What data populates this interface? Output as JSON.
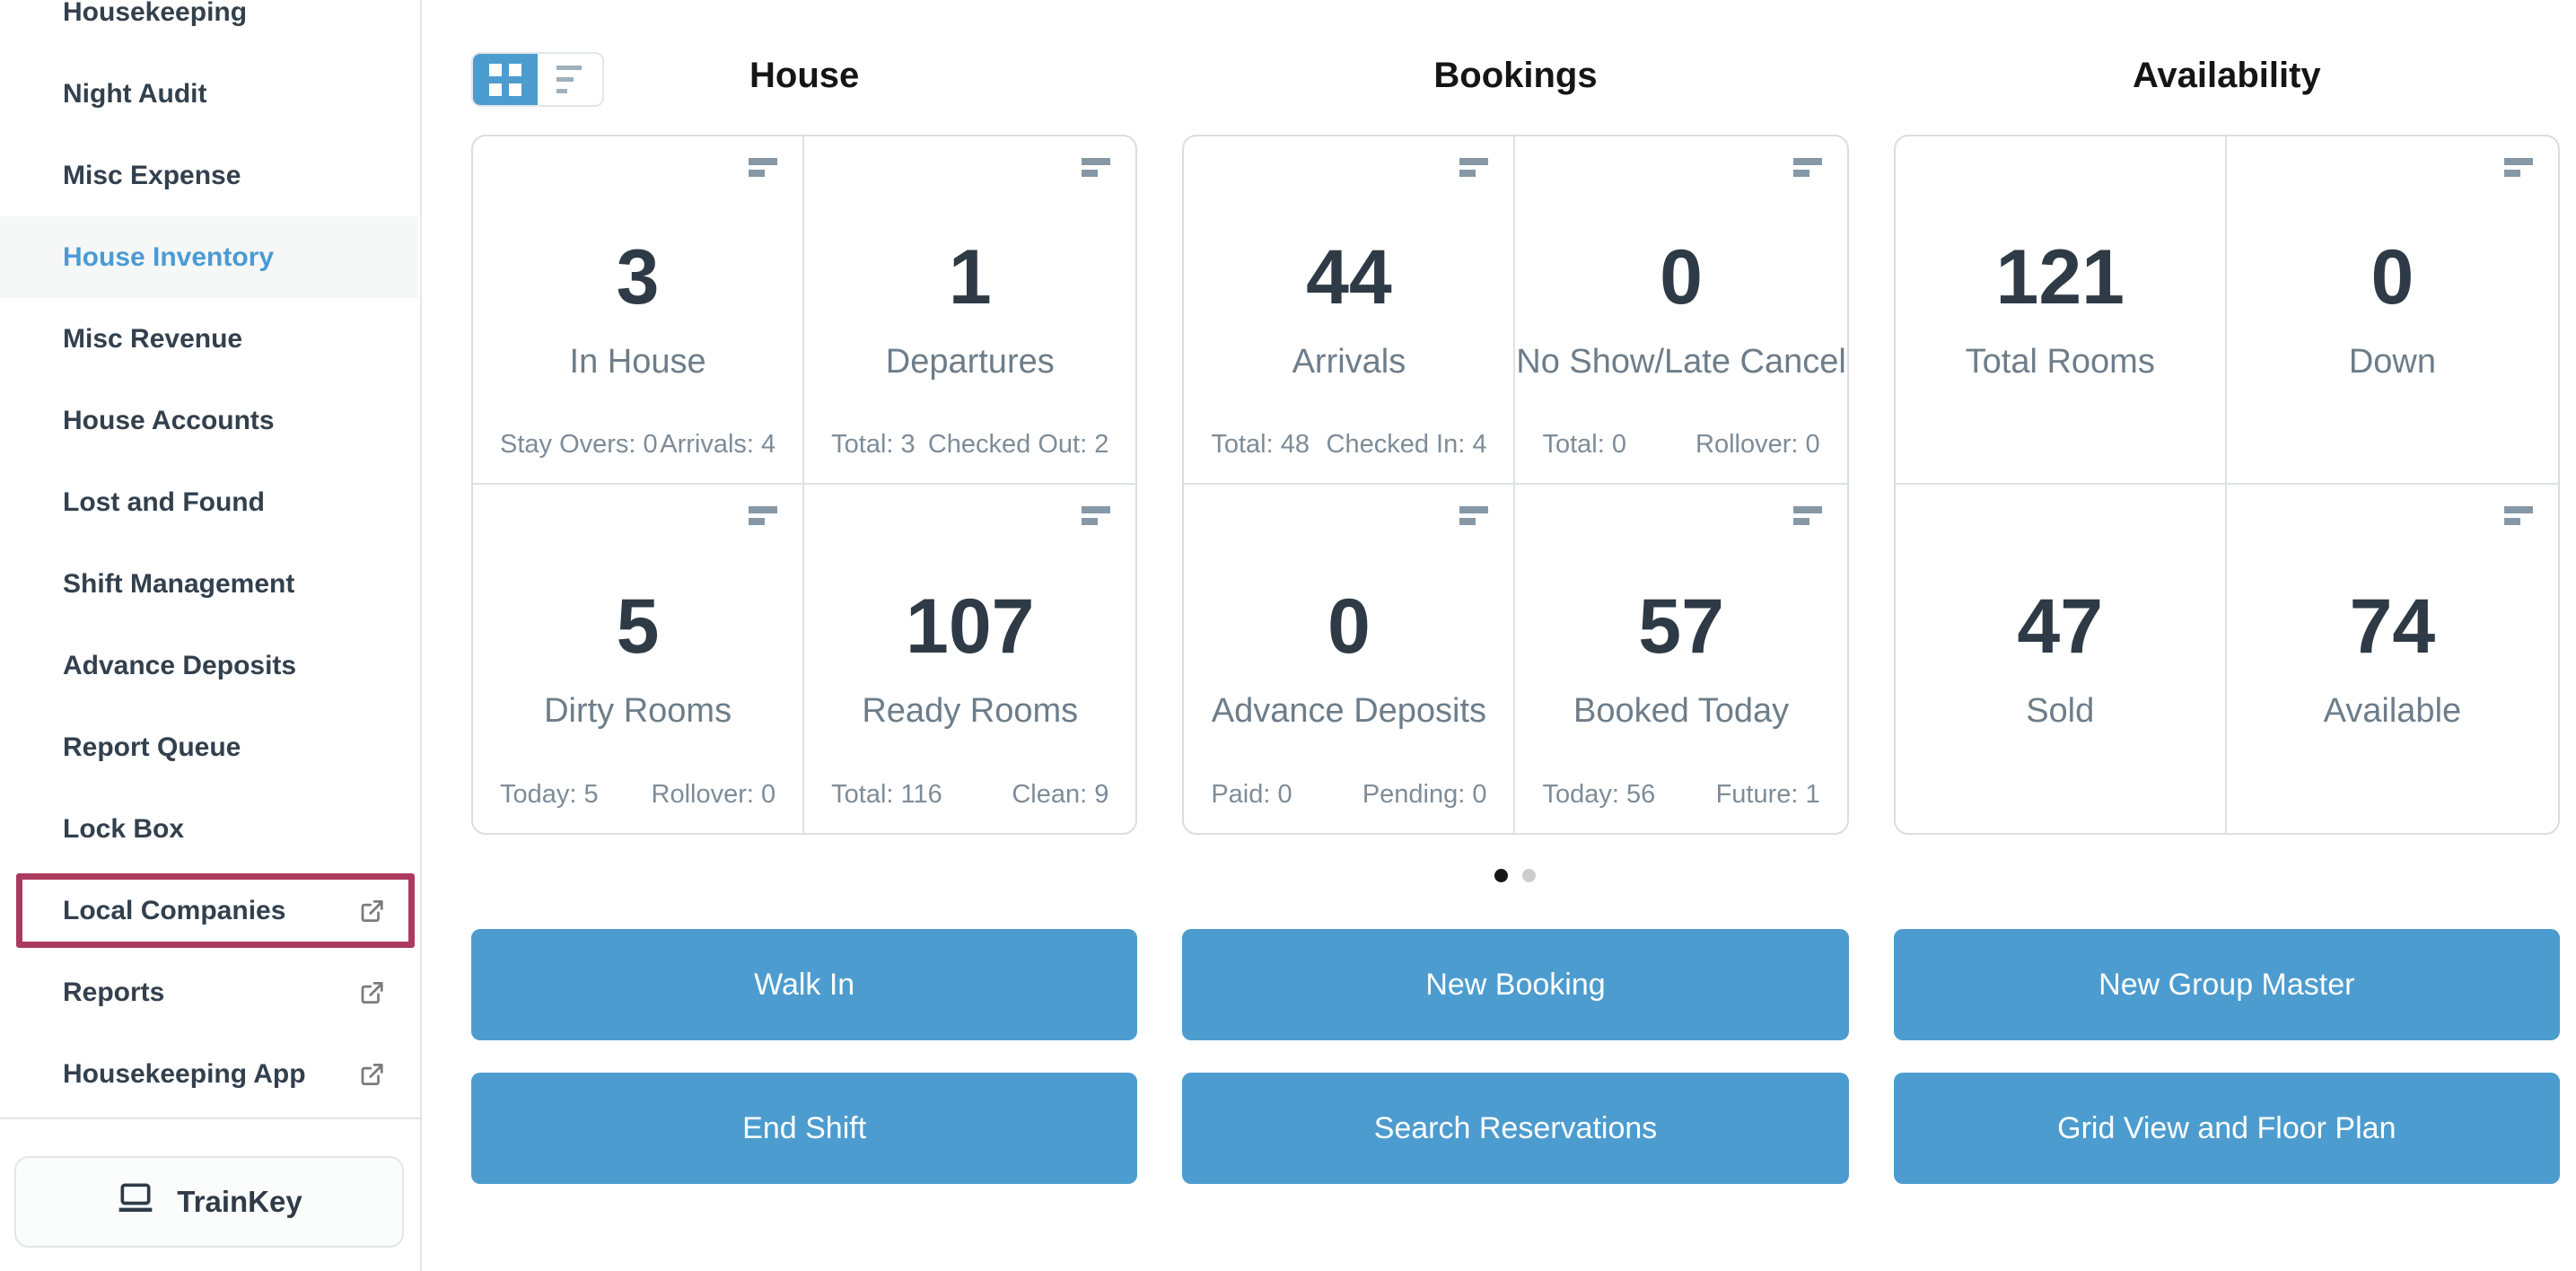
{
  "sidebar": {
    "items": [
      {
        "label": "Housekeeping"
      },
      {
        "label": "Night Audit"
      },
      {
        "label": "Misc Expense"
      },
      {
        "label": "House Inventory",
        "active": true
      },
      {
        "label": "Misc Revenue"
      },
      {
        "label": "House Accounts"
      },
      {
        "label": "Lost and Found"
      },
      {
        "label": "Shift Management"
      },
      {
        "label": "Advance Deposits"
      },
      {
        "label": "Report Queue"
      },
      {
        "label": "Lock Box"
      },
      {
        "label": "Local Companies",
        "external": true,
        "highlighted": true
      },
      {
        "label": "Reports",
        "external": true
      },
      {
        "label": "Housekeeping App",
        "external": true
      }
    ],
    "trainkey_label": "TrainKey"
  },
  "view_toggle": {
    "options": [
      "grid-view",
      "list-view"
    ],
    "selected": "grid-view"
  },
  "columns": [
    {
      "title": "House",
      "cards": [
        {
          "value": "3",
          "label": "In House",
          "footer_left": "Stay Overs: 0",
          "footer_right": "Arrivals: 4"
        },
        {
          "value": "1",
          "label": "Departures",
          "footer_left": "Total: 3",
          "footer_right": "Checked Out: 2"
        },
        {
          "value": "5",
          "label": "Dirty Rooms",
          "footer_left": "Today: 5",
          "footer_right": "Rollover: 0"
        },
        {
          "value": "107",
          "label": "Ready Rooms",
          "footer_left": "Total: 116",
          "footer_right": "Clean: 9"
        }
      ],
      "buttons": [
        "Walk In",
        "End Shift"
      ]
    },
    {
      "title": "Bookings",
      "cards": [
        {
          "value": "44",
          "label": "Arrivals",
          "footer_left": "Total: 48",
          "footer_right": "Checked In: 4"
        },
        {
          "value": "0",
          "label": "No Show/Late Cancel",
          "footer_left": "Total: 0",
          "footer_right": "Rollover: 0"
        },
        {
          "value": "0",
          "label": "Advance Deposits",
          "footer_left": "Paid: 0",
          "footer_right": "Pending: 0"
        },
        {
          "value": "57",
          "label": "Booked Today",
          "footer_left": "Today: 56",
          "footer_right": "Future: 1"
        }
      ],
      "buttons": [
        "New Booking",
        "Search Reservations"
      ]
    },
    {
      "title": "Availability",
      "cards": [
        {
          "value": "121",
          "label": "Total Rooms"
        },
        {
          "value": "0",
          "label": "Down"
        },
        {
          "value": "47",
          "label": "Sold"
        },
        {
          "value": "74",
          "label": "Available"
        }
      ],
      "buttons": [
        "New Group Master",
        "Grid View and Floor Plan"
      ]
    }
  ],
  "pagination": {
    "dot_count": 2,
    "active_index": 0
  },
  "colors": {
    "accent_blue": "#4d9ccf",
    "active_link_blue": "#4a9bd4",
    "highlight_maroon": "#ac3a5e",
    "number_dark": "#2e3a45",
    "label_gray": "#6d7d89",
    "dot_active": "#161616",
    "dot_inactive": "#cdcdcd"
  }
}
